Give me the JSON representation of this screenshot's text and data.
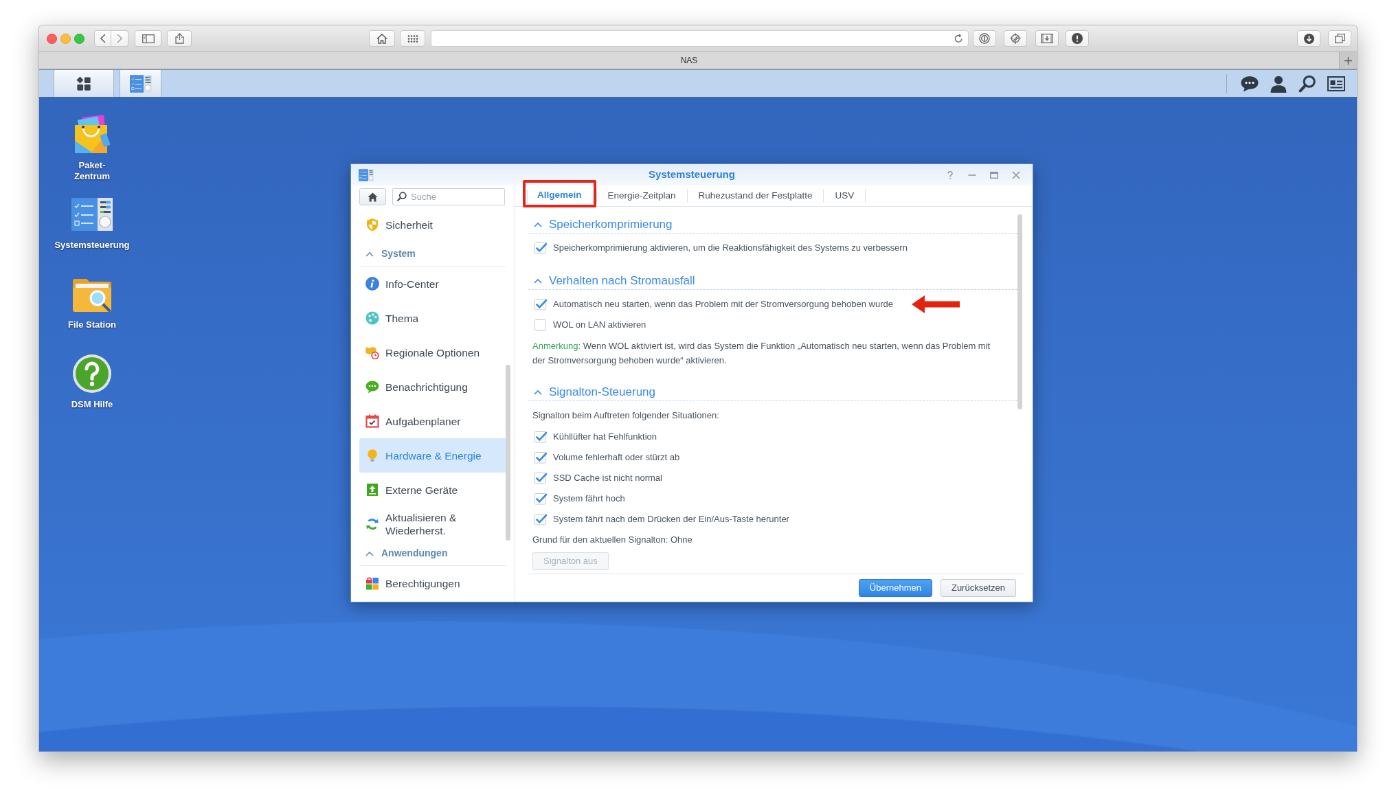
{
  "browser": {
    "tab_title": "NAS"
  },
  "desktop_icons": [
    {
      "label": "Paket-\nZentrum"
    },
    {
      "label": "Systemsteuerung"
    },
    {
      "label": "File Station"
    },
    {
      "label": "DSM Hilfe"
    }
  ],
  "window": {
    "title": "Systemsteuerung",
    "search": {
      "placeholder": "Suche"
    },
    "sidebar": {
      "items": [
        {
          "kind": "item",
          "label": "Sicherheit",
          "selected": false
        },
        {
          "kind": "group",
          "label": "System",
          "expanded": true
        },
        {
          "kind": "item",
          "label": "Info-Center",
          "selected": false
        },
        {
          "kind": "item",
          "label": "Thema",
          "selected": false
        },
        {
          "kind": "item",
          "label": "Regionale Optionen",
          "selected": false
        },
        {
          "kind": "item",
          "label": "Benachrichtigung",
          "selected": false
        },
        {
          "kind": "item",
          "label": "Aufgabenplaner",
          "selected": false
        },
        {
          "kind": "item",
          "label": "Hardware & Energie",
          "selected": true
        },
        {
          "kind": "item",
          "label": "Externe Geräte",
          "selected": false
        },
        {
          "kind": "item",
          "label": "Aktualisieren & Wiederherst.",
          "selected": false
        },
        {
          "kind": "group",
          "label": "Anwendungen",
          "expanded": true
        },
        {
          "kind": "item",
          "label": "Berechtigungen",
          "selected": false
        }
      ]
    },
    "tabs": [
      {
        "label": "Allgemein",
        "selected": true,
        "annotated": true
      },
      {
        "label": "Energie-Zeitplan",
        "selected": false,
        "annotated": false
      },
      {
        "label": "Ruhezustand der Festplatte",
        "selected": false,
        "annotated": false
      },
      {
        "label": "USV",
        "selected": false,
        "annotated": false
      }
    ],
    "sections": [
      {
        "title": "Speicherkomprimierung",
        "expanded": true,
        "rows": [
          {
            "kind": "checkbox",
            "label": "Speicherkomprimierung aktivieren, um die Reaktionsfähigkeit des Systems zu verbessern",
            "checked": true,
            "annotated": false
          }
        ]
      },
      {
        "title": "Verhalten nach Stromausfall",
        "expanded": true,
        "rows": [
          {
            "kind": "checkbox",
            "label": "Automatisch neu starten, wenn das Problem mit der Stromversorgung behoben wurde",
            "checked": true,
            "annotated": true
          },
          {
            "kind": "checkbox",
            "label": "WOL on LAN aktivieren",
            "checked": false,
            "annotated": false
          },
          {
            "kind": "note",
            "label": "Anmerkung:",
            "text": "Wenn WOL aktiviert ist, wird das System die Funktion „Automatisch neu starten, wenn das Problem mit der Stromversorgung behoben wurde“ aktivieren."
          }
        ]
      },
      {
        "title": "Signalton-Steuerung",
        "expanded": true,
        "rows": [
          {
            "kind": "text",
            "text": "Signalton beim Auftreten folgender Situationen:"
          },
          {
            "kind": "checkbox",
            "label": "Kühllüfter hat Fehlfunktion",
            "checked": true,
            "annotated": false
          },
          {
            "kind": "checkbox",
            "label": "Volume fehlerhaft oder stürzt ab",
            "checked": true,
            "annotated": false
          },
          {
            "kind": "checkbox",
            "label": "SSD Cache ist nicht normal",
            "checked": true,
            "annotated": false
          },
          {
            "kind": "checkbox",
            "label": "System fährt hoch",
            "checked": true,
            "annotated": false
          },
          {
            "kind": "checkbox",
            "label": "System fährt nach dem Drücken der Ein/Aus-Taste herunter",
            "checked": true,
            "annotated": false
          },
          {
            "kind": "text",
            "text": "Grund für den aktuellen Signalton: Ohne"
          },
          {
            "kind": "button",
            "label": "Signalton aus",
            "disabled": true
          }
        ]
      }
    ],
    "buttons": [
      {
        "kind": "primary",
        "label": "Übernehmen"
      },
      {
        "kind": "secondary",
        "label": "Zurücksetzen"
      }
    ]
  }
}
